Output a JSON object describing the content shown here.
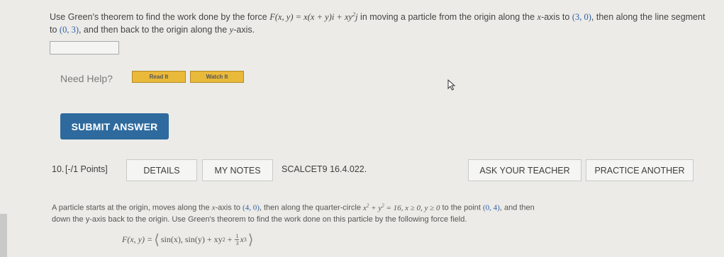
{
  "previous_problem": {
    "t1": "Use Green's theorem to find the work done by the force ",
    "F": "F(x, y) = x(x + y)i + xy",
    "exp": "2",
    "j": "j",
    "t2": " in moving a particle from the origin along the ",
    "xaxis": "x",
    "t3": "-axis to ",
    "p1": "(3, 0)",
    "t4": ", then along the line segment to ",
    "p2": "(0, 3)",
    "t5": ", and then back to the origin along the ",
    "yaxis": "y",
    "t6": "-axis."
  },
  "answer_input": {
    "value": ""
  },
  "help": {
    "label": "Need Help?",
    "read_label": "Read It",
    "watch_label": "Watch It"
  },
  "submit_label": "SUBMIT ANSWER",
  "question": {
    "number": "10.",
    "points": "[-/1 Points]",
    "details_label": "DETAILS",
    "notes_label": "MY NOTES",
    "code": "SCALCET9 16.4.022.",
    "ask_label": "ASK YOUR TEACHER",
    "practice_label": "PRACTICE ANOTHER",
    "text": {
      "a": "A particle starts at the origin, moves along the ",
      "b": "x",
      "c": "-axis to ",
      "d": "(4, 0)",
      "e": ", then along the quarter-circle ",
      "f": "x",
      "g": "2",
      "h": " + y",
      "i": "2",
      "j": " = 16, x ≥ 0, y ≥ 0",
      "k": " to the point ",
      "l": "(0, 4)",
      "m": ", and then",
      "line2": "down the y-axis back to the origin. Use Green's theorem to find the work done on this particle by the following force field."
    },
    "formula": {
      "lhs": "F(x, y) = ",
      "part1": "sin(x), sin(y) + xy",
      "sup1": "2",
      "plus": " + ",
      "num": "1",
      "den": "3",
      "x": "x",
      "sup2": "3"
    }
  }
}
